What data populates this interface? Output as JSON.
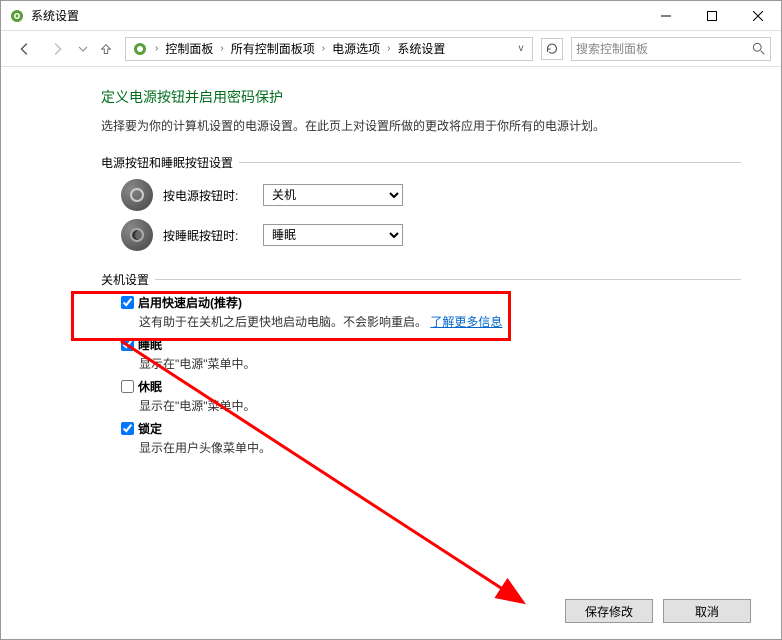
{
  "window": {
    "title": "系统设置"
  },
  "breadcrumb": {
    "items": [
      "控制面板",
      "所有控制面板项",
      "电源选项",
      "系统设置"
    ]
  },
  "search": {
    "placeholder": "搜索控制面板"
  },
  "page": {
    "heading": "定义电源按钮并启用密码保护",
    "description": "选择要为你的计算机设置的电源设置。在此页上对设置所做的更改将应用于你所有的电源计划。"
  },
  "button_settings": {
    "title": "电源按钮和睡眠按钮设置",
    "power_label": "按电源按钮时:",
    "power_value": "关机",
    "sleep_label": "按睡眠按钮时:",
    "sleep_value": "睡眠"
  },
  "shutdown": {
    "title": "关机设置",
    "fast_startup": {
      "label": "启用快速启动(推荐)",
      "checked": true,
      "desc": "这有助于在关机之后更快地启动电脑。不会影响重启。",
      "link": "了解更多信息"
    },
    "sleep": {
      "label": "睡眠",
      "checked": true,
      "desc": "显示在\"电源\"菜单中。"
    },
    "hibernate": {
      "label": "休眠",
      "checked": false,
      "desc": "显示在\"电源\"菜单中。"
    },
    "lock": {
      "label": "锁定",
      "checked": true,
      "desc": "显示在用户头像菜单中。"
    }
  },
  "footer": {
    "save": "保存修改",
    "cancel": "取消"
  }
}
